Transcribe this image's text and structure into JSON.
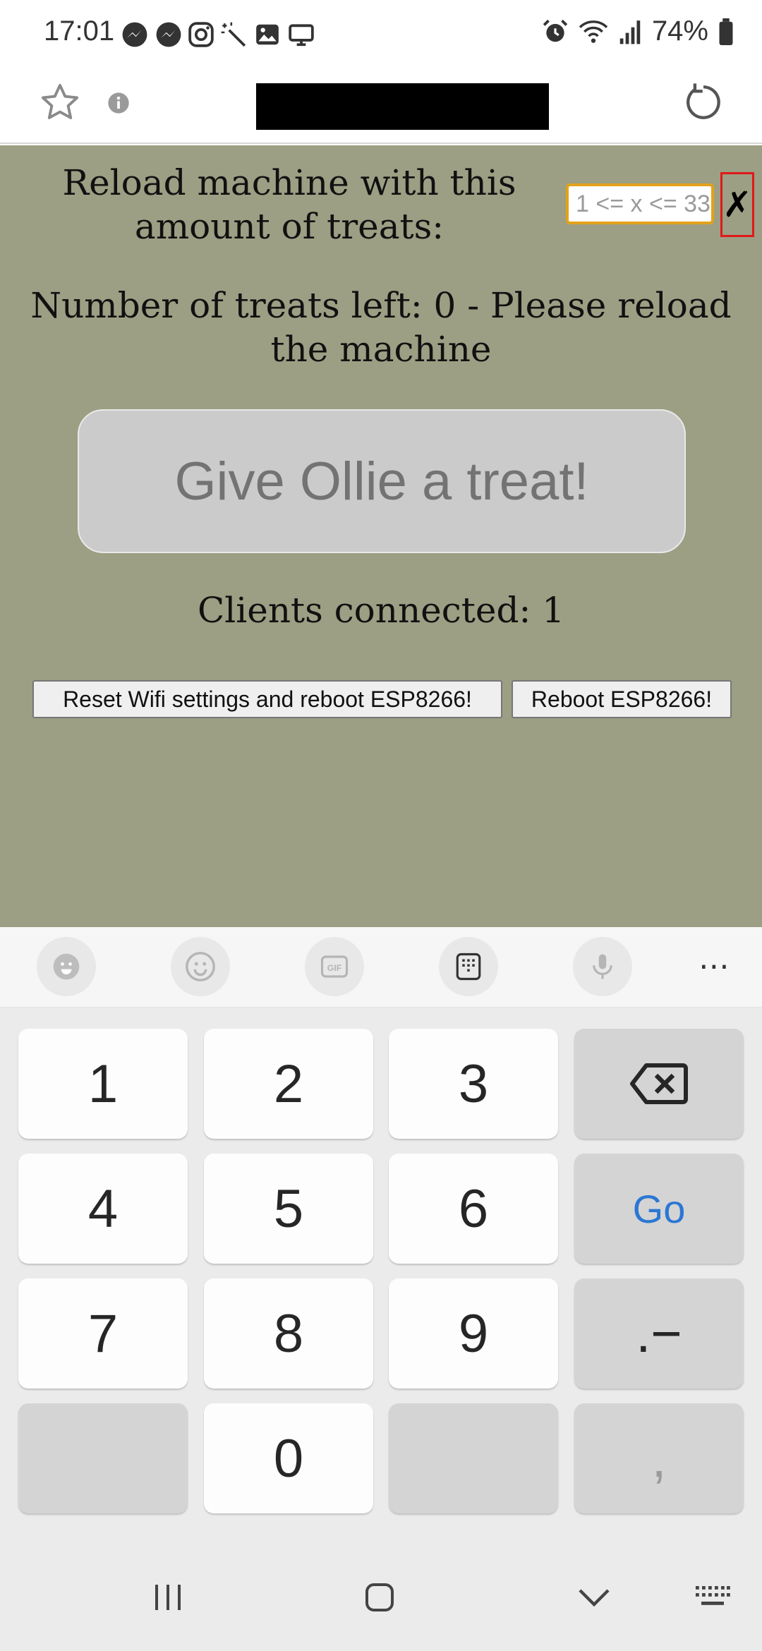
{
  "status_bar": {
    "time": "17:01",
    "battery": "74%",
    "left_icons": [
      "messenger-icon",
      "messenger-icon",
      "instagram-icon",
      "magic-wand-icon",
      "gallery-icon",
      "screen-icon"
    ],
    "right_icons": [
      "alarm-icon",
      "wifi-icon",
      "signal-icon",
      "battery-icon"
    ]
  },
  "browser": {
    "icons": [
      "star-icon",
      "info-icon",
      "reload-icon"
    ]
  },
  "page": {
    "background": "#9c9f83",
    "reload_label": "Reload machine with this amount of treats:",
    "reload_input_placeholder": "1 <= x <= 33",
    "cancel_label": "✗",
    "treats_left": "Number of treats left: 0 - Please reload the machine",
    "treat_button": "Give Ollie a treat!",
    "clients": "Clients connected: 1",
    "reset_wifi_button": "Reset Wifi settings and reboot ESP8266!",
    "reboot_button": "Reboot ESP8266!"
  },
  "keyboard": {
    "toolbar_icons": [
      "sticker-icon",
      "emoji-icon",
      "gif-icon",
      "keypad-icon",
      "mic-icon",
      "more-icon"
    ],
    "more_label": "⋯",
    "keys": {
      "k1": "1",
      "k2": "2",
      "k3": "3",
      "k4": "4",
      "k5": "5",
      "k6": "6",
      "k7": "7",
      "k8": "8",
      "k9": "9",
      "k0": "0",
      "go": "Go",
      "dot_dash": ".−",
      "comma": ","
    },
    "accent_color": "#2b77d4"
  },
  "nav_bar": {
    "icons": [
      "recents-icon",
      "home-icon",
      "back-icon",
      "keyboard-icon"
    ]
  }
}
